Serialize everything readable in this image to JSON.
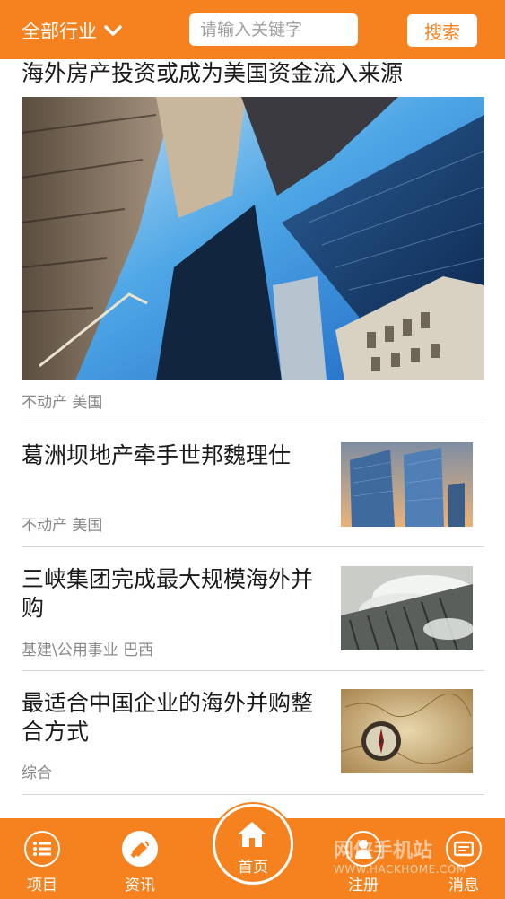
{
  "header": {
    "industry_label": "全部行业",
    "search_placeholder": "请输入关键字",
    "search_button": "搜索"
  },
  "feature": {
    "title": "海外房产投资或成为美国资金流入来源",
    "tags": "不动产 美国"
  },
  "articles": [
    {
      "title": "葛洲坝地产牵手世邦魏理仕",
      "tags": "不动产 美国"
    },
    {
      "title": "三峡集团完成最大规模海外并购",
      "tags": "基建\\公用事业 巴西"
    },
    {
      "title": "最适合中国企业的海外并购整合方式",
      "tags": "综合"
    }
  ],
  "nav": {
    "projects": "项目",
    "news": "资讯",
    "home": "首页",
    "register": "注册",
    "messages": "消息"
  },
  "watermark": {
    "text": "网侠手机站",
    "url": "WWW.HACKHOME.COM"
  },
  "colors": {
    "accent": "#f5821f",
    "text": "#1a1a1a",
    "muted": "#888888"
  }
}
